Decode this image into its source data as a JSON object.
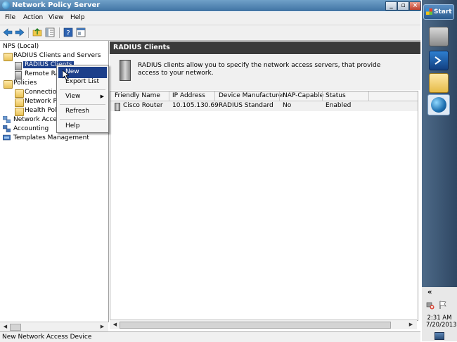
{
  "window": {
    "title": "Network Policy Server",
    "caption_buttons": {
      "minimize": "_",
      "restore": "▫",
      "close": "×"
    }
  },
  "menu": [
    "File",
    "Action",
    "View",
    "Help"
  ],
  "tree": {
    "root": "NPS (Local)",
    "radius_group": "RADIUS Clients and Servers",
    "radius_clients": "RADIUS Clients",
    "remote_radius": "Remote RA",
    "policies": "Policies",
    "connection": "Connection",
    "network_policies": "Network Po",
    "health_policies": "Health Polic",
    "network_access": "Network Acces",
    "accounting": "Accounting",
    "templates": "Templates Management"
  },
  "context_menu": {
    "new": "New",
    "export_list": "Export List",
    "view": "View",
    "refresh": "Refresh",
    "help": "Help"
  },
  "pane": {
    "header": "RADIUS Clients",
    "description": "RADIUS clients allow you to specify the network access servers, that provide access to your network.",
    "columns": [
      "Friendly Name",
      "IP Address",
      "Device Manufacturer",
      "NAP-Capable",
      "Status"
    ],
    "rows": [
      [
        "Cisco Router",
        "10.105.130.69",
        "RADIUS Standard",
        "No",
        "Enabled"
      ]
    ]
  },
  "status_bar": "New Network Access Device",
  "taskbar": {
    "start": "Start",
    "expand": "«",
    "time": "2:31 AM",
    "date": "7/20/2013"
  }
}
